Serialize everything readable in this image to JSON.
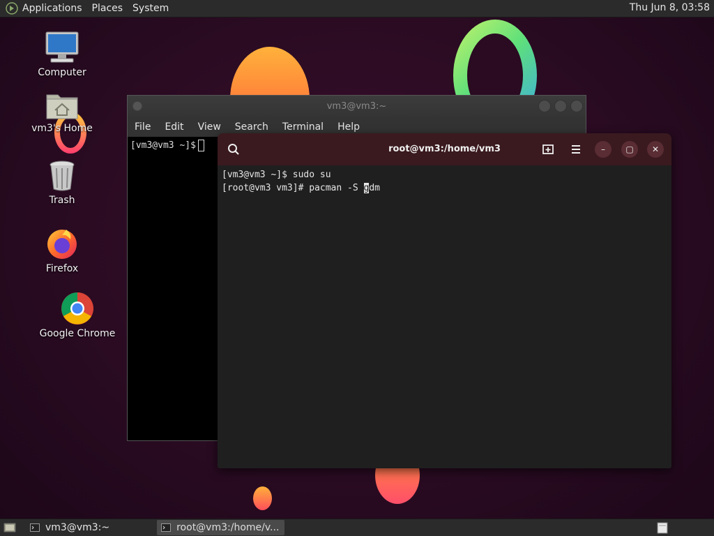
{
  "top_panel": {
    "menus": [
      "Applications",
      "Places",
      "System"
    ],
    "clock": "Thu Jun  8, 03:58"
  },
  "desktop_icons": [
    {
      "label": "Computer",
      "icon": "computer-icon"
    },
    {
      "label": "vm3's Home",
      "icon": "home-folder-icon"
    },
    {
      "label": "Trash",
      "icon": "trash-icon"
    },
    {
      "label": "Firefox",
      "icon": "firefox-icon"
    },
    {
      "label": "Google Chrome",
      "icon": "chrome-icon"
    }
  ],
  "back_terminal": {
    "title": "vm3@vm3:~",
    "menus": [
      "File",
      "Edit",
      "View",
      "Search",
      "Terminal",
      "Help"
    ],
    "prompt": "[vm3@vm3 ~]$"
  },
  "front_terminal": {
    "title": "root@vm3:/home/vm3",
    "lines": {
      "line1": "[vm3@vm3 ~]$ sudo su",
      "line2_prefix": "[root@vm3 vm3]# pacman -S ",
      "line2_cursor_char": "g",
      "line2_suffix": "dm"
    },
    "buttons": {
      "minimize": "–",
      "maximize": "▢",
      "close": "✕"
    }
  },
  "taskbar": {
    "tasks": [
      "vm3@vm3:~",
      "root@vm3:/home/v..."
    ]
  },
  "colors": {
    "header_bg": "#3a1a1f",
    "panel_bg": "#2b2b2b",
    "desktop_bg": "#2a0b22"
  }
}
